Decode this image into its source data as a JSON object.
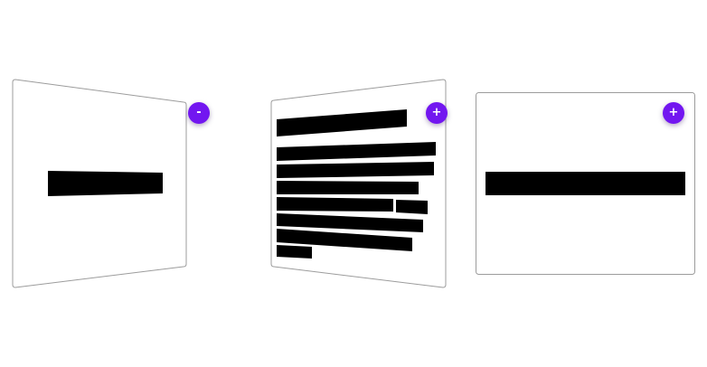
{
  "accent_color": "#7216f0",
  "cards": [
    {
      "name": "card-left",
      "state": "collapsed",
      "toggle_label": "-"
    },
    {
      "name": "card-center",
      "state": "expanded",
      "toggle_label": "+"
    },
    {
      "name": "card-right",
      "state": "collapsed",
      "toggle_label": "+"
    }
  ]
}
